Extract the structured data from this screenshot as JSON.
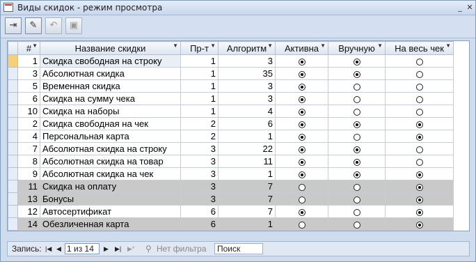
{
  "window": {
    "title": "Виды скидок - режим просмотра"
  },
  "grid": {
    "columns": [
      "#",
      "Название скидки",
      "Пр-т",
      "Алгоритм",
      "Активна",
      "Вручную",
      "На весь чек"
    ],
    "rows": [
      {
        "id": "1",
        "name": "Скидка свободная на строку",
        "pr": "1",
        "alg": "3",
        "active": true,
        "manual": true,
        "whole": false,
        "grey": false,
        "current": true
      },
      {
        "id": "3",
        "name": "Абсолютная скидка",
        "pr": "1",
        "alg": "35",
        "active": true,
        "manual": true,
        "whole": false,
        "grey": false,
        "current": false
      },
      {
        "id": "5",
        "name": "Временная скидка",
        "pr": "1",
        "alg": "3",
        "active": true,
        "manual": false,
        "whole": false,
        "grey": false,
        "current": false
      },
      {
        "id": "6",
        "name": "Скидка на сумму чека",
        "pr": "1",
        "alg": "3",
        "active": true,
        "manual": false,
        "whole": false,
        "grey": false,
        "current": false
      },
      {
        "id": "10",
        "name": "Скидка на наборы",
        "pr": "1",
        "alg": "4",
        "active": true,
        "manual": false,
        "whole": false,
        "grey": false,
        "current": false
      },
      {
        "id": "2",
        "name": "Скидка свободная на чек",
        "pr": "2",
        "alg": "6",
        "active": true,
        "manual": true,
        "whole": true,
        "grey": false,
        "current": false
      },
      {
        "id": "4",
        "name": "Персональная карта",
        "pr": "2",
        "alg": "1",
        "active": true,
        "manual": false,
        "whole": true,
        "grey": false,
        "current": false
      },
      {
        "id": "7",
        "name": "Абсолютная скидка на строку",
        "pr": "3",
        "alg": "22",
        "active": true,
        "manual": true,
        "whole": false,
        "grey": false,
        "current": false
      },
      {
        "id": "8",
        "name": "Абсолютная скидка на товар",
        "pr": "3",
        "alg": "11",
        "active": true,
        "manual": true,
        "whole": false,
        "grey": false,
        "current": false
      },
      {
        "id": "9",
        "name": "Абсолютная скидка на чек",
        "pr": "3",
        "alg": "1",
        "active": true,
        "manual": true,
        "whole": true,
        "grey": false,
        "current": false
      },
      {
        "id": "11",
        "name": "Скидка на оплату",
        "pr": "3",
        "alg": "7",
        "active": false,
        "manual": false,
        "whole": true,
        "grey": true,
        "current": false
      },
      {
        "id": "13",
        "name": "Бонусы",
        "pr": "3",
        "alg": "7",
        "active": false,
        "manual": false,
        "whole": true,
        "grey": true,
        "current": false
      },
      {
        "id": "12",
        "name": "Автосертификат",
        "pr": "6",
        "alg": "7",
        "active": true,
        "manual": false,
        "whole": true,
        "grey": false,
        "current": false
      },
      {
        "id": "14",
        "name": "Обезличенная карта",
        "pr": "6",
        "alg": "1",
        "active": false,
        "manual": false,
        "whole": true,
        "grey": true,
        "current": false
      }
    ]
  },
  "status": {
    "record_label": "Запись:",
    "record_value": "1 из 14",
    "filter_label": "Нет фильтра",
    "search_placeholder": "Поиск"
  }
}
